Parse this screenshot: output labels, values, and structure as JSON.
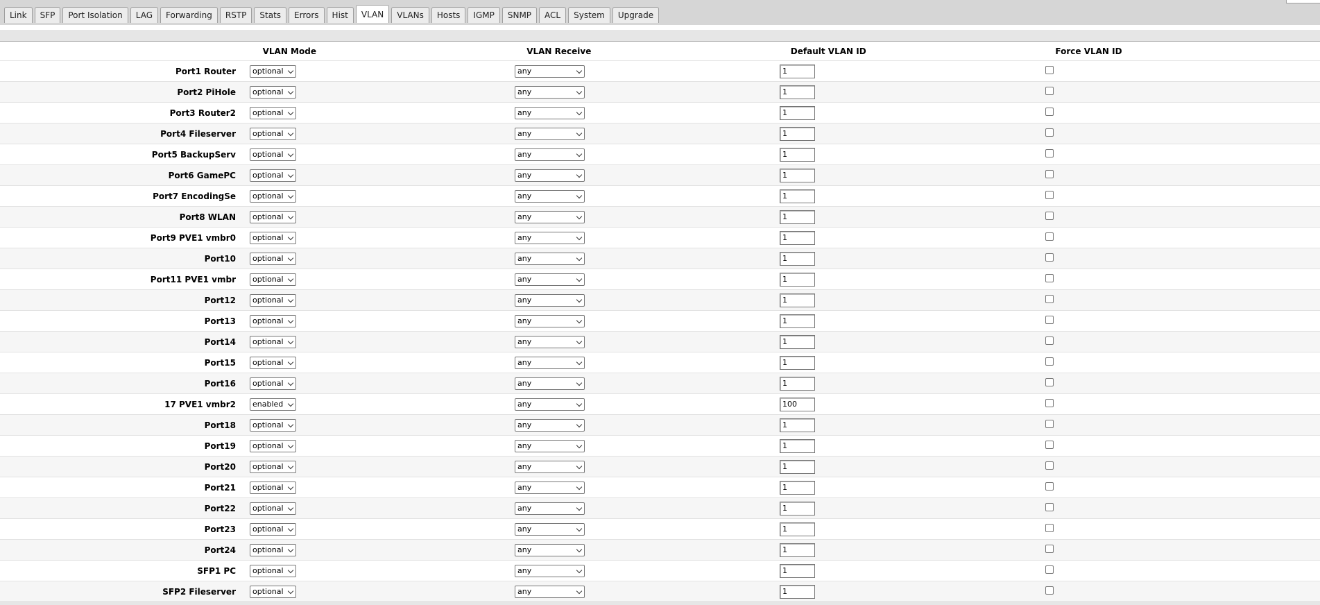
{
  "tabs": [
    "Link",
    "SFP",
    "Port Isolation",
    "LAG",
    "Forwarding",
    "RSTP",
    "Stats",
    "Errors",
    "Hist",
    "VLAN",
    "VLANs",
    "Hosts",
    "IGMP",
    "SNMP",
    "ACL",
    "System",
    "Upgrade"
  ],
  "active_tab": "VLAN",
  "columns": {
    "mode": "VLAN Mode",
    "receive": "VLAN Receive",
    "default_id": "Default VLAN ID",
    "force": "Force VLAN ID"
  },
  "ports": [
    {
      "name": "Port1 Router",
      "mode": "optional",
      "receive": "any",
      "vlan_id": "1",
      "force": false
    },
    {
      "name": "Port2 PiHole",
      "mode": "optional",
      "receive": "any",
      "vlan_id": "1",
      "force": false
    },
    {
      "name": "Port3 Router2",
      "mode": "optional",
      "receive": "any",
      "vlan_id": "1",
      "force": false
    },
    {
      "name": "Port4 Fileserver",
      "mode": "optional",
      "receive": "any",
      "vlan_id": "1",
      "force": false
    },
    {
      "name": "Port5 BackupServ",
      "mode": "optional",
      "receive": "any",
      "vlan_id": "1",
      "force": false
    },
    {
      "name": "Port6 GamePC",
      "mode": "optional",
      "receive": "any",
      "vlan_id": "1",
      "force": false
    },
    {
      "name": "Port7 EncodingSe",
      "mode": "optional",
      "receive": "any",
      "vlan_id": "1",
      "force": false
    },
    {
      "name": "Port8 WLAN",
      "mode": "optional",
      "receive": "any",
      "vlan_id": "1",
      "force": false
    },
    {
      "name": "Port9 PVE1 vmbr0",
      "mode": "optional",
      "receive": "any",
      "vlan_id": "1",
      "force": false
    },
    {
      "name": "Port10",
      "mode": "optional",
      "receive": "any",
      "vlan_id": "1",
      "force": false
    },
    {
      "name": "Port11 PVE1 vmbr",
      "mode": "optional",
      "receive": "any",
      "vlan_id": "1",
      "force": false
    },
    {
      "name": "Port12",
      "mode": "optional",
      "receive": "any",
      "vlan_id": "1",
      "force": false
    },
    {
      "name": "Port13",
      "mode": "optional",
      "receive": "any",
      "vlan_id": "1",
      "force": false
    },
    {
      "name": "Port14",
      "mode": "optional",
      "receive": "any",
      "vlan_id": "1",
      "force": false
    },
    {
      "name": "Port15",
      "mode": "optional",
      "receive": "any",
      "vlan_id": "1",
      "force": false
    },
    {
      "name": "Port16",
      "mode": "optional",
      "receive": "any",
      "vlan_id": "1",
      "force": false
    },
    {
      "name": "17 PVE1 vmbr2",
      "mode": "enabled",
      "receive": "any",
      "vlan_id": "100",
      "force": false
    },
    {
      "name": "Port18",
      "mode": "optional",
      "receive": "any",
      "vlan_id": "1",
      "force": false
    },
    {
      "name": "Port19",
      "mode": "optional",
      "receive": "any",
      "vlan_id": "1",
      "force": false
    },
    {
      "name": "Port20",
      "mode": "optional",
      "receive": "any",
      "vlan_id": "1",
      "force": false
    },
    {
      "name": "Port21",
      "mode": "optional",
      "receive": "any",
      "vlan_id": "1",
      "force": false
    },
    {
      "name": "Port22",
      "mode": "optional",
      "receive": "any",
      "vlan_id": "1",
      "force": false
    },
    {
      "name": "Port23",
      "mode": "optional",
      "receive": "any",
      "vlan_id": "1",
      "force": false
    },
    {
      "name": "Port24",
      "mode": "optional",
      "receive": "any",
      "vlan_id": "1",
      "force": false
    },
    {
      "name": "SFP1 PC",
      "mode": "optional",
      "receive": "any",
      "vlan_id": "1",
      "force": false
    },
    {
      "name": "SFP2 Fileserver",
      "mode": "optional",
      "receive": "any",
      "vlan_id": "1",
      "force": false
    }
  ]
}
